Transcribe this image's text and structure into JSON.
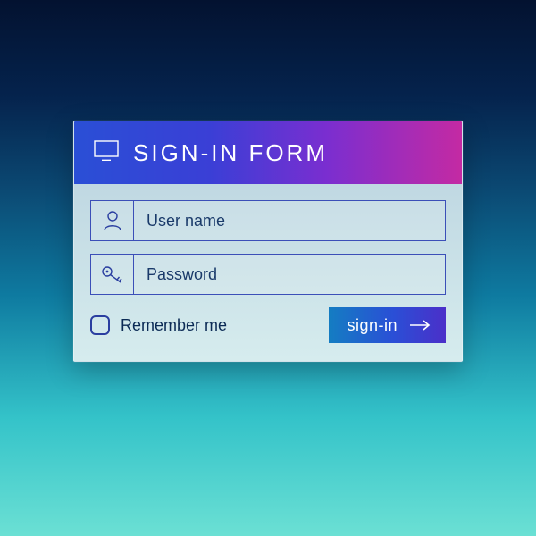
{
  "header": {
    "title": "SIGN-IN FORM"
  },
  "fields": {
    "username": {
      "placeholder": "User name",
      "value": ""
    },
    "password": {
      "placeholder": "Password",
      "value": ""
    }
  },
  "remember": {
    "label": "Remember me",
    "checked": false
  },
  "submit": {
    "label": "sign-in"
  }
}
